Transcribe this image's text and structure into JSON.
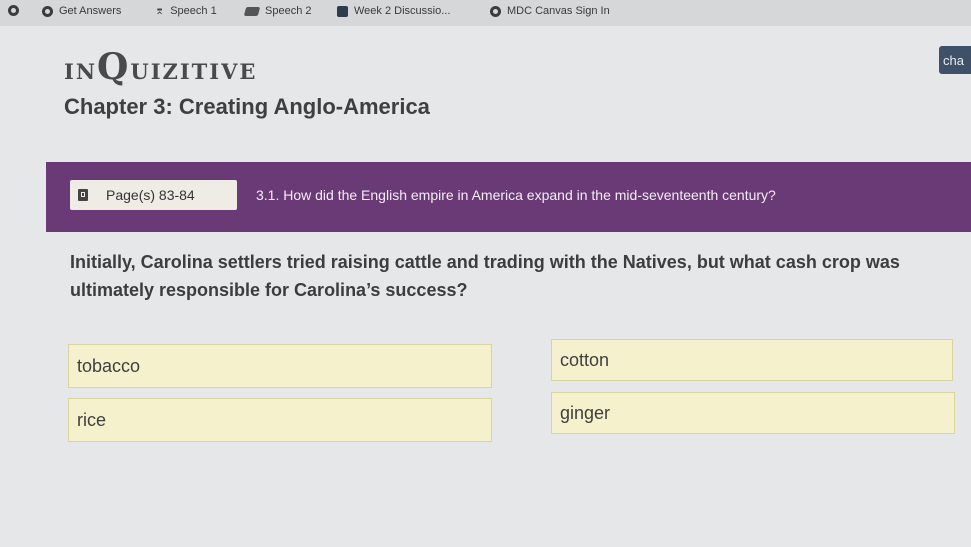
{
  "bookmarks": [
    {
      "label": "",
      "icon": "globe-icon"
    },
    {
      "label": "Get Answers",
      "icon": "globe-icon"
    },
    {
      "label": "Speech 1",
      "icon": "speech-icon"
    },
    {
      "label": "Speech 2",
      "icon": "speech-icon"
    },
    {
      "label": "Week 2 Discussio...",
      "icon": "discussion-icon"
    },
    {
      "label": "MDC Canvas Sign In",
      "icon": "globe-icon"
    }
  ],
  "brand": {
    "prefix": "in",
    "big_letter": "Q",
    "suffix": "uizitive"
  },
  "search_stub": "cha",
  "chapter_title": "Chapter 3: Creating Anglo-America",
  "banner": {
    "pages": "Page(s) 83-84",
    "objective": "3.1. How did the English empire in America expand in the mid-seventeenth century?"
  },
  "question": "Initially, Carolina settlers tried raising cattle and trading with the Natives, but what cash crop was ultimately responsible for Carolina’s success?",
  "answers": [
    "tobacco",
    "cotton",
    "rice",
    "ginger"
  ],
  "colors": {
    "banner": "#6a3a76",
    "answer_bg": "#f4f1cc",
    "search_bg": "#3f5168"
  }
}
